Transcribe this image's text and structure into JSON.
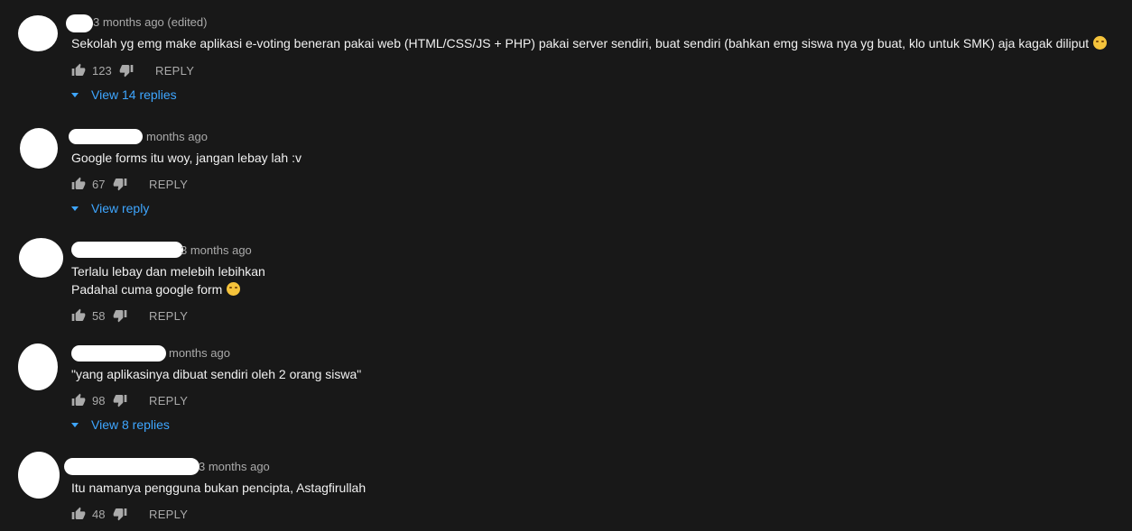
{
  "comments": [
    {
      "time": "3 months ago (edited)",
      "text_lines": [
        "Sekolah yg emg make aplikasi e-voting beneran pakai web (HTML/CSS/JS + PHP) pakai server sendiri, buat sendiri (bahkan emg siswa nya yg buat, klo untuk SMK) aja kagak diliput"
      ],
      "emoji": "pensive-face",
      "likes": "123",
      "reply_label": "REPLY",
      "view_replies": "View 14 replies"
    },
    {
      "time": "months ago",
      "text_lines": [
        "Google forms itu woy, jangan lebay lah :v"
      ],
      "likes": "67",
      "reply_label": "REPLY",
      "view_replies": "View reply"
    },
    {
      "time": "3 months ago",
      "text_lines": [
        "Terlalu lebay dan melebih lebihkan",
        "Padahal cuma google form"
      ],
      "emoji": "zany-face",
      "likes": "58",
      "reply_label": "REPLY"
    },
    {
      "time": "months ago",
      "text_lines": [
        "\"yang aplikasinya dibuat sendiri oleh 2 orang siswa\""
      ],
      "likes": "98",
      "reply_label": "REPLY",
      "view_replies": "View 8 replies"
    },
    {
      "time": "3 months ago",
      "text_lines": [
        "Itu namanya pengguna bukan pencipta, Astagfirullah"
      ],
      "likes": "48",
      "reply_label": "REPLY"
    }
  ],
  "colors": {
    "background": "#181818",
    "text": "#f1f1f1",
    "secondary_text": "#aaaaaa",
    "link": "#3ea6ff",
    "redaction": "#ffffff"
  },
  "icons": {
    "like": "thumbs-up-icon",
    "dislike": "thumbs-down-icon",
    "expand": "caret-down-icon"
  }
}
